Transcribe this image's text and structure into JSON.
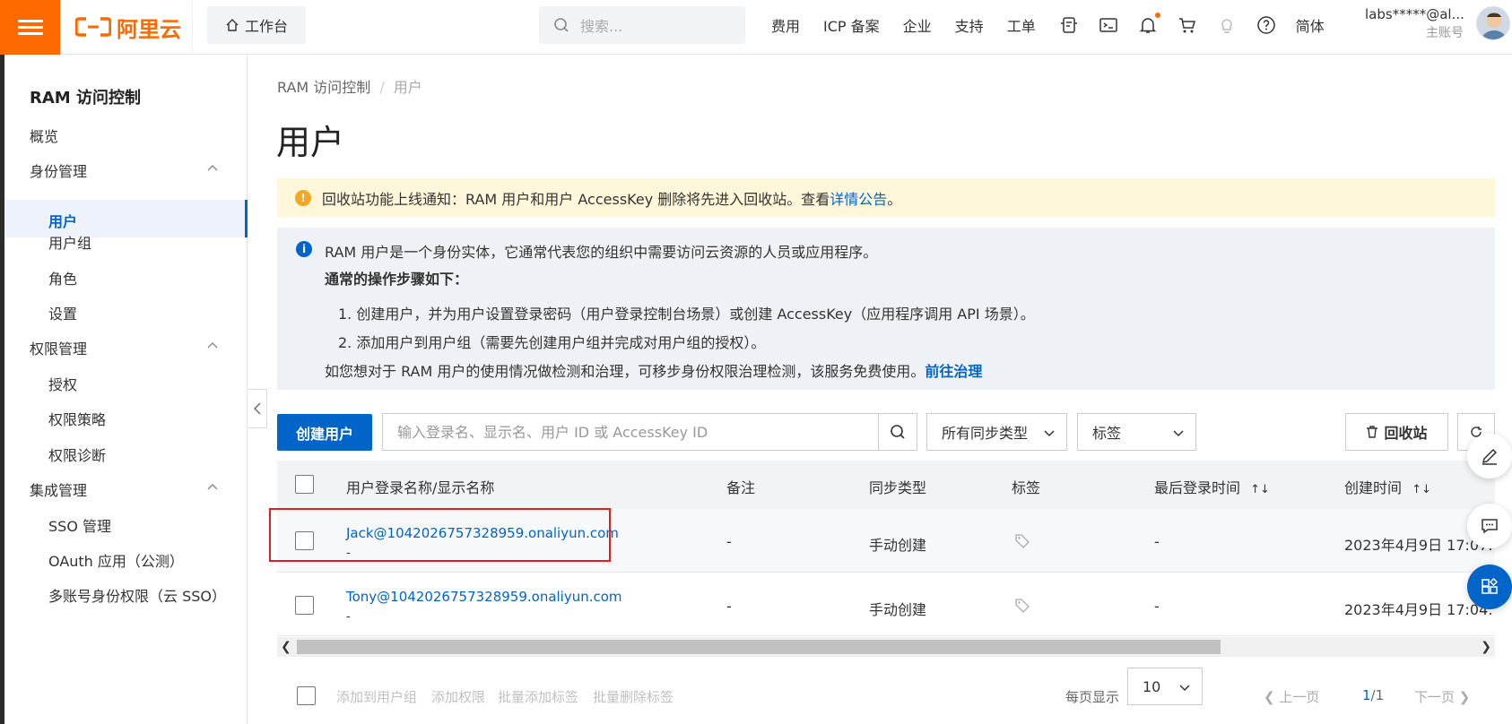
{
  "topbar": {
    "logo_text": "阿里云",
    "workbench": "工作台",
    "search_placeholder": "搜索...",
    "nav": [
      "费用",
      "ICP 备案",
      "企业",
      "支持",
      "工单"
    ],
    "lang": "简体",
    "account_name": "labs*****@al...",
    "account_type": "主账号"
  },
  "sidebar": {
    "title": "RAM 访问控制",
    "overview": "概览",
    "group_identity": "身份管理",
    "users": "用户",
    "user_groups": "用户组",
    "roles": "角色",
    "settings": "设置",
    "group_permission": "权限管理",
    "grants": "授权",
    "policies": "权限策略",
    "diagnosis": "权限诊断",
    "group_integration": "集成管理",
    "sso": "SSO 管理",
    "oauth": "OAuth 应用（公测）",
    "multi_account": "多账号身份权限（云 SSO）"
  },
  "breadcrumb": {
    "root": "RAM 访问控制",
    "sep": "/",
    "current": "用户"
  },
  "page_title": "用户",
  "notice_yellow": {
    "text": "回收站功能上线通知：RAM 用户和用户 AccessKey 删除将先进入回收站。查看",
    "link": "详情公告",
    "end": "。"
  },
  "notice_blue": {
    "intro": "RAM 用户是一个身份实体，它通常代表您的组织中需要访问云资源的人员或应用程序。",
    "steps_title": "通常的操作步骤如下：",
    "step1": "1. 创建用户，并为用户设置登录密码（用户登录控制台场景）或创建 AccessKey（应用程序调用 API 场景）。",
    "step2": "2. 添加用户到用户组（需要先创建用户组并完成对用户组的授权）。",
    "footer": "如您想对于 RAM 用户的使用情况做检测和治理，可移步身份权限治理检测，该服务免费使用。",
    "footer_link": "前往治理"
  },
  "toolbar": {
    "create_user": "创建用户",
    "search_placeholder": "输入登录名、显示名、用户 ID 或 AccessKey ID",
    "sync_type": "所有同步类型",
    "tag": "标签",
    "recycle_bin": "回收站"
  },
  "table": {
    "headers": [
      "用户登录名称/显示名称",
      "备注",
      "同步类型",
      "标签",
      "最后登录时间",
      "创建时间"
    ],
    "rows": [
      {
        "login": "Jack@1042026757328959.onaliyun.com",
        "display": "-",
        "note": "-",
        "sync": "手动创建",
        "last_login": "-",
        "created": "2023年4月9日 17:07:"
      },
      {
        "login": "Tony@1042026757328959.onaliyun.com",
        "display": "-",
        "note": "-",
        "sync": "手动创建",
        "last_login": "-",
        "created": "2023年4月9日 17:04:"
      }
    ]
  },
  "footer": {
    "add_to_group": "添加到用户组",
    "add_permission": "添加权限",
    "batch_add_tag": "批量添加标签",
    "batch_remove_tag": "批量删除标签",
    "per_page_label": "每页显示",
    "per_page": "10",
    "prev": "上一页",
    "page_current": "1",
    "page_total": "/1",
    "next": "下一页"
  },
  "colors": {
    "brand": "#ff6a00",
    "primary": "#0064c8",
    "highlight": "#e02020"
  }
}
